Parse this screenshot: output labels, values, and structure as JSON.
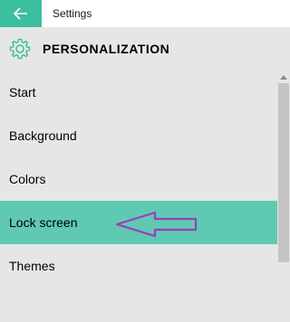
{
  "window": {
    "title": "Settings",
    "back_icon": "arrow-left-icon",
    "accent_color": "#3cbf9e"
  },
  "header": {
    "icon": "gear-icon",
    "title": "PERSONALIZATION"
  },
  "menu": {
    "items": [
      {
        "label": "Start",
        "selected": false
      },
      {
        "label": "Background",
        "selected": false
      },
      {
        "label": "Colors",
        "selected": false
      },
      {
        "label": "Lock screen",
        "selected": true
      },
      {
        "label": "Themes",
        "selected": false
      }
    ],
    "selected_color": "#60c9b4"
  },
  "annotation": {
    "type": "arrow",
    "points_to": "Lock screen",
    "color": "#9b3fb5"
  }
}
